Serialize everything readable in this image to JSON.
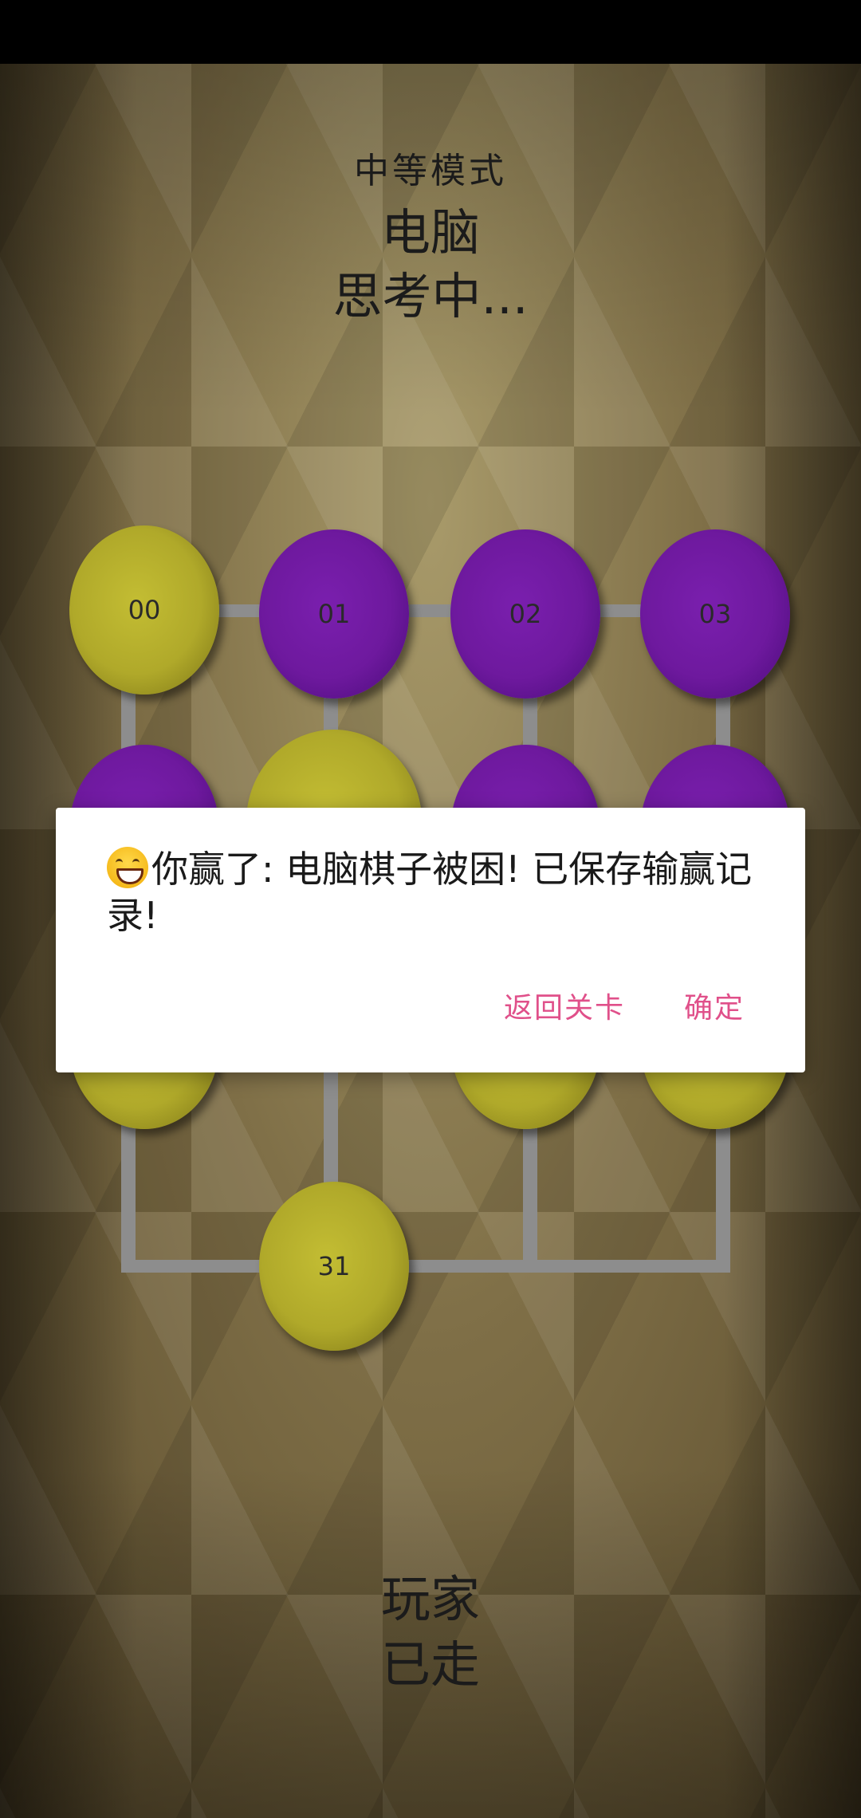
{
  "header": {
    "mode": "中等模式",
    "computer_label": "电脑",
    "computer_status": "思考中..."
  },
  "footer": {
    "player_label": "玩家",
    "player_status": "已走"
  },
  "pieces": [
    {
      "id": "00",
      "color": "yellow",
      "label": "00"
    },
    {
      "id": "01",
      "color": "purple",
      "label": "01"
    },
    {
      "id": "02",
      "color": "purple",
      "label": "02"
    },
    {
      "id": "03",
      "color": "purple",
      "label": "03"
    },
    {
      "id": "10",
      "color": "purple",
      "label": ""
    },
    {
      "id": "11",
      "color": "yellow",
      "label": ""
    },
    {
      "id": "12",
      "color": "purple",
      "label": ""
    },
    {
      "id": "13",
      "color": "purple",
      "label": ""
    },
    {
      "id": "20",
      "color": "yellow",
      "label": ""
    },
    {
      "id": "22",
      "color": "yellow",
      "label": ""
    },
    {
      "id": "23",
      "color": "yellow",
      "label": ""
    },
    {
      "id": "31",
      "color": "yellow",
      "label": "31"
    }
  ],
  "colors": {
    "yellow_piece": "#b0a92a",
    "purple_piece": "#6e199e",
    "board_line": "#8d8d8d",
    "accent": "#e0508a"
  },
  "dialog": {
    "emoji_icon": "grinning-face-icon",
    "message": "你赢了: 电脑棋子被困! 已保存输赢记录!",
    "back_button": "返回关卡",
    "ok_button": "确定"
  }
}
